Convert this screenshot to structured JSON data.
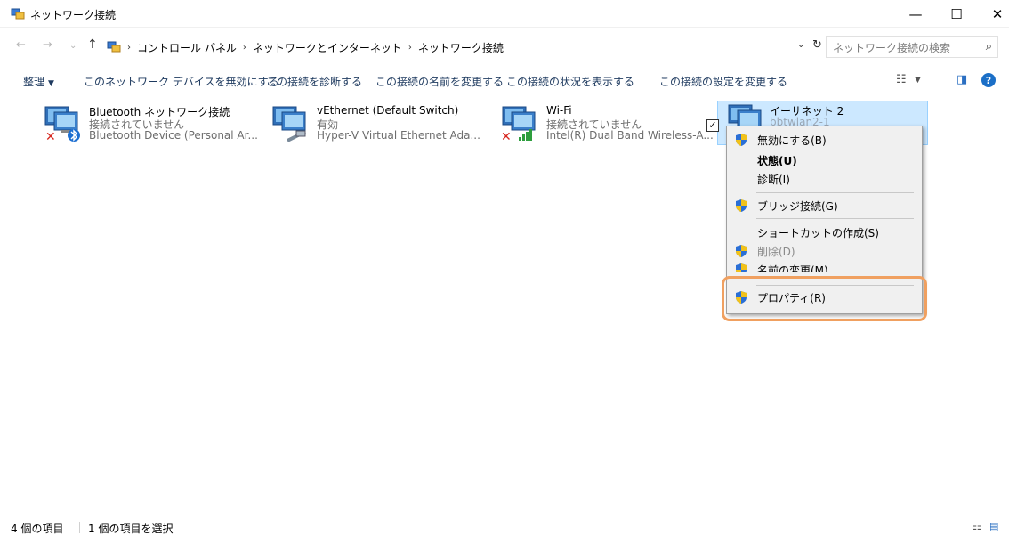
{
  "window": {
    "title": "ネットワーク接続",
    "min_glyph": "—",
    "max_glyph": "☐",
    "close_glyph": "✕"
  },
  "address": {
    "back_glyph": "←",
    "forward_glyph": "→",
    "recent_glyph": "⌄",
    "up_glyph": "↑",
    "crumbs": [
      "コントロール パネル",
      "ネットワークとインターネット",
      "ネットワーク接続"
    ],
    "separator": "›",
    "dropdown_glyph": "⌄",
    "refresh_glyph": "↻",
    "search_placeholder": "ネットワーク接続の検索",
    "search_glyph": "⌕"
  },
  "toolbar": {
    "organize": "整理",
    "organize_caret": "▼",
    "commands": [
      "このネットワーク デバイスを無効にする",
      "この接続を診断する",
      "この接続の名前を変更する",
      "この接続の状況を表示する",
      "この接続の設定を変更する"
    ],
    "view_glyph": "☷",
    "view_caret": "▼",
    "pane_glyph": "◨",
    "help_glyph": "?"
  },
  "adapters": [
    {
      "name": "Bluetooth ネットワーク接続",
      "status": "接続されていません",
      "device": "Bluetooth Device (Personal Ar...",
      "badge_icon": "bluetooth-icon",
      "disconnected": true
    },
    {
      "name": "vEthernet (Default Switch)",
      "status": "有効",
      "device": "Hyper-V Virtual Ethernet Ada...",
      "badge_icon": "ethernet-cable-icon",
      "disconnected": false
    },
    {
      "name": "Wi-Fi",
      "status": "接続されていません",
      "device": "Intel(R) Dual Band Wireless-A...",
      "badge_icon": "wifi-signal-icon",
      "disconnected": true
    },
    {
      "name": "イーサネット 2",
      "status": "bbtwlan2-1",
      "device": "",
      "badge_icon": "network-adapter-icon",
      "disconnected": false,
      "selected": true,
      "checkmark": "✓"
    }
  ],
  "context_menu": {
    "items": [
      {
        "label": "無効にする(B)",
        "shield": true
      },
      {
        "label": "状態(U)",
        "shield": false,
        "bold": true
      },
      {
        "label": "診断(I)",
        "shield": false
      },
      {
        "label": "ブリッジ接続(G)",
        "shield": true
      },
      {
        "label": "ショートカットの作成(S)",
        "shield": false
      },
      {
        "label": "削除(D)",
        "shield": true,
        "disabled": true
      },
      {
        "label": "名前の変更(M)",
        "shield": true
      },
      {
        "label": "プロパティ(R)",
        "shield": true
      }
    ]
  },
  "status_bar": {
    "item_count": "4 個の項目",
    "selected_count": "1 個の項目を選択",
    "details_view_glyph": "☷",
    "tiles_view_glyph": "▤"
  },
  "colors": {
    "selection_bg": "#cce8ff",
    "highlight_frame": "#f0a060",
    "link_text": "#1e3a5f"
  }
}
